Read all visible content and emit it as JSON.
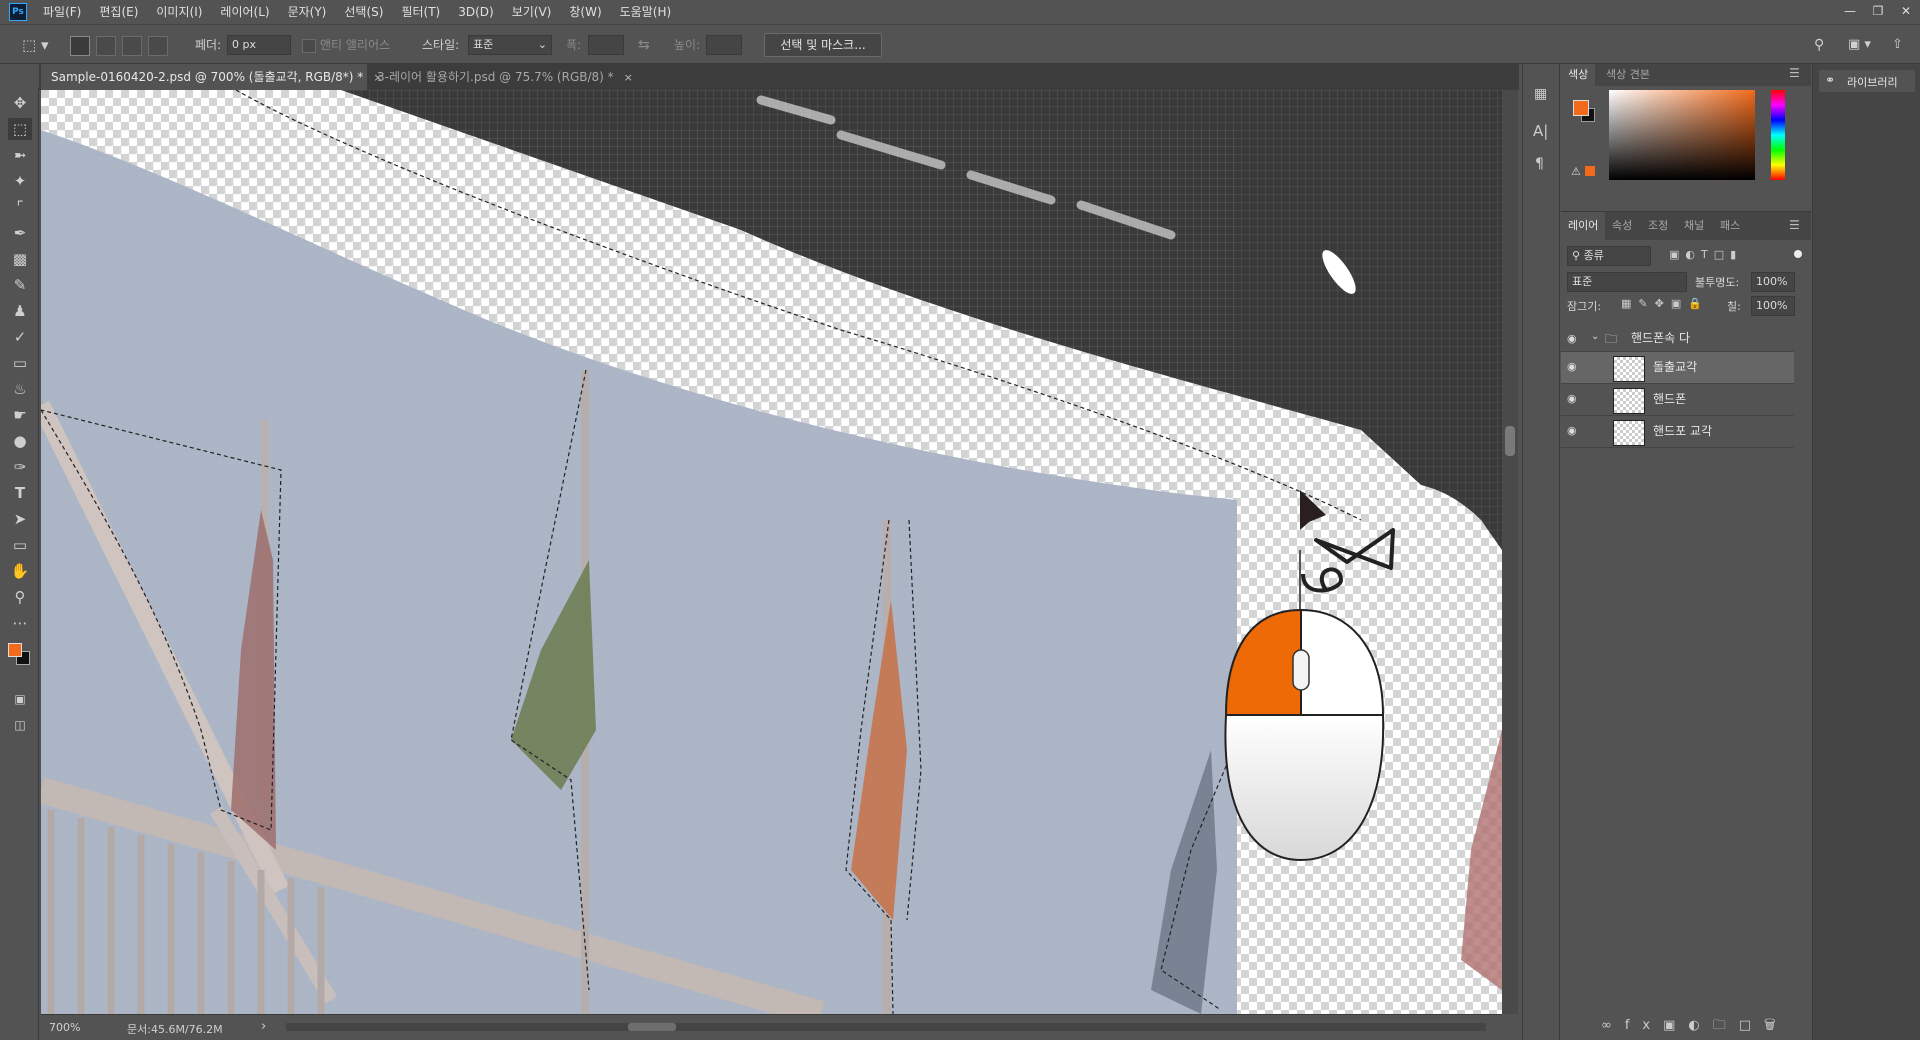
{
  "app": {
    "logo": "Ps"
  },
  "menu": [
    "파일(F)",
    "편집(E)",
    "이미지(I)",
    "레이어(L)",
    "문자(Y)",
    "선택(S)",
    "필터(T)",
    "3D(D)",
    "보기(V)",
    "창(W)",
    "도움말(H)"
  ],
  "options": {
    "feather_label": "페더:",
    "feather_value": "0 px",
    "antialias_label": "앤티 앨리어스",
    "style_label": "스타일:",
    "style_value": "표준",
    "width_label": "폭:",
    "height_label": "높이:",
    "select_mask_button": "선택 및 마스크..."
  },
  "tabs": [
    {
      "label": "Sample-0160420-2.psd @ 700% (돌출교각, RGB/8*) *",
      "close": "×"
    },
    {
      "label": "3-레이어 활용하기.psd @ 75.7% (RGB/8) *",
      "close": "×"
    }
  ],
  "status": {
    "zoom": "700%",
    "doc": "문서:45.6M/76.2M",
    "arrow": "›"
  },
  "color_panel": {
    "tabs": [
      "색상",
      "색상 견본"
    ],
    "fg": "#f26a1b",
    "bg": "#111111"
  },
  "layers_panel": {
    "tabs": [
      "레이어",
      "속성",
      "조정",
      "채널",
      "패스"
    ],
    "filter_label": "종류",
    "blend_mode": "표준",
    "opacity_label": "불투명도:",
    "opacity_value": "100%",
    "lock_label": "잠그기:",
    "fill_label": "칠:",
    "fill_value": "100%",
    "group_name": "핸드폰속 다",
    "layers": [
      {
        "name": "돌출교각",
        "selected": true
      },
      {
        "name": "핸드폰",
        "selected": false
      },
      {
        "name": "핸드포 교각",
        "selected": false
      }
    ]
  },
  "library": {
    "label": "라이브러리"
  },
  "colors": {
    "accent": "#f26a1b",
    "panel": "#535353",
    "dark": "#3c3c3c"
  }
}
